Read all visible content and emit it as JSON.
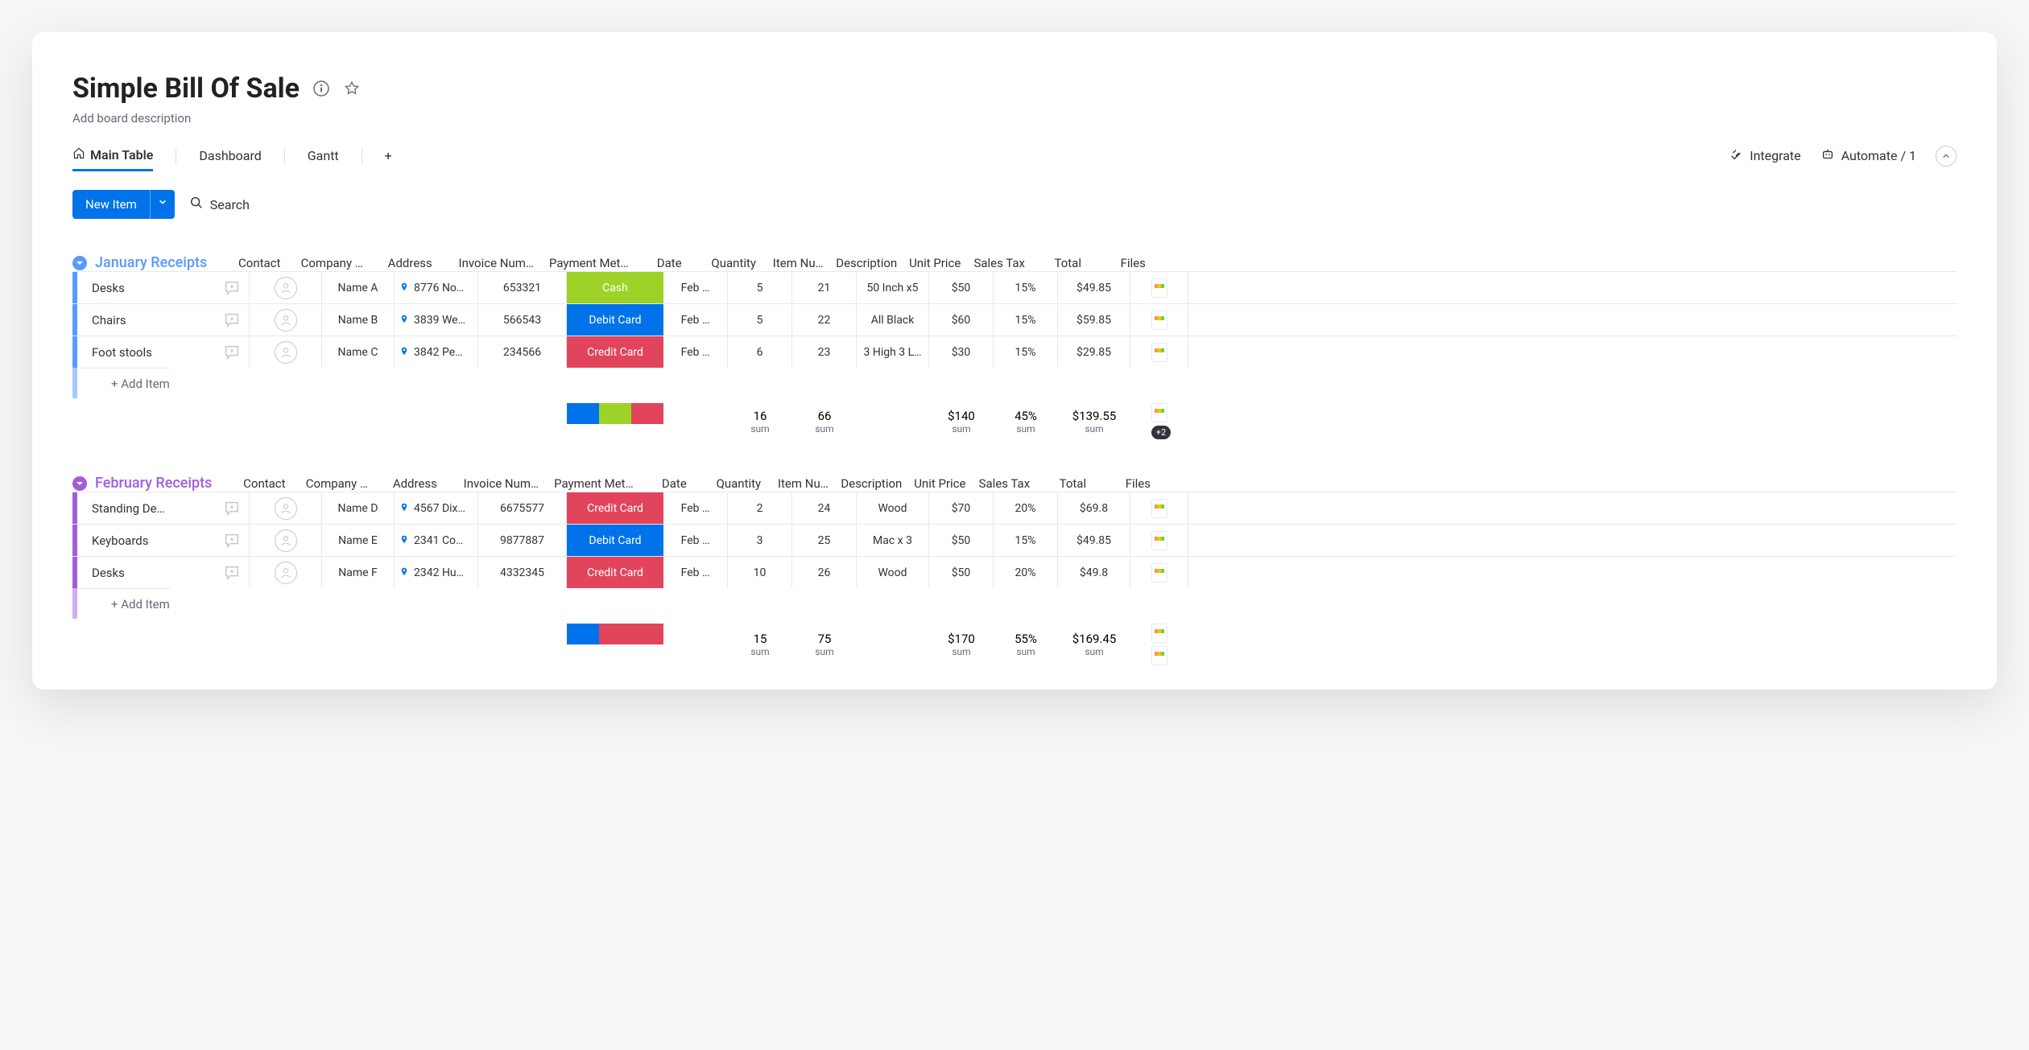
{
  "board": {
    "title": "Simple Bill Of Sale",
    "description_placeholder": "Add board description",
    "tabs": {
      "main": "Main Table",
      "dashboard": "Dashboard",
      "gantt": "Gantt",
      "add": "+"
    },
    "integrate": "Integrate",
    "automate": "Automate / 1",
    "new_item": "New Item",
    "search": "Search",
    "add_item": "+ Add Item",
    "sum_label": "sum",
    "files_more": "+2"
  },
  "columns": {
    "contact": "Contact",
    "company": "Company …",
    "address": "Address",
    "invoice": "Invoice Num…",
    "payment": "Payment Met…",
    "date": "Date",
    "quantity": "Quantity",
    "item_num": "Item Nu…",
    "description": "Description",
    "unit_price": "Unit Price",
    "sales_tax": "Sales Tax",
    "total": "Total",
    "files": "Files"
  },
  "groups": [
    {
      "name": "January Receipts",
      "color": "#579bfc",
      "nameColor": "#579bfc",
      "rows": [
        {
          "item": "Desks",
          "company": "Name A",
          "address": "8776 No…",
          "invoice": "653321",
          "payment": "Cash",
          "pay_class": "pay-cash",
          "date": "Feb …",
          "qty": "5",
          "item_num": "21",
          "desc": "50 Inch x5",
          "unit": "$50",
          "tax": "15%",
          "total": "$49.85"
        },
        {
          "item": "Chairs",
          "company": "Name B",
          "address": "3839 We…",
          "invoice": "566543",
          "payment": "Debit Card",
          "pay_class": "pay-debit",
          "date": "Feb …",
          "qty": "5",
          "item_num": "22",
          "desc": "All Black",
          "unit": "$60",
          "tax": "15%",
          "total": "$59.85"
        },
        {
          "item": "Foot stools",
          "company": "Name C",
          "address": "3842 Pe…",
          "invoice": "234566",
          "payment": "Credit Card",
          "pay_class": "pay-credit",
          "date": "Feb …",
          "qty": "6",
          "item_num": "23",
          "desc": "3 High 3 L…",
          "unit": "$30",
          "tax": "15%",
          "total": "$29.85"
        }
      ],
      "dist": [
        {
          "c": "#0073ea",
          "w": "33.33%"
        },
        {
          "c": "#9cd326",
          "w": "33.33%"
        },
        {
          "c": "#e2445c",
          "w": "33.34%"
        }
      ],
      "sums": {
        "qty": "16",
        "item_num": "66",
        "unit": "$140",
        "tax": "45%",
        "total": "$139.55",
        "files_more": "+2"
      }
    },
    {
      "name": "February Receipts",
      "color": "#a25ddc",
      "nameColor": "#a25ddc",
      "rows": [
        {
          "item": "Standing De…",
          "company": "Name D",
          "address": "4567 Dix…",
          "invoice": "6675577",
          "payment": "Credit Card",
          "pay_class": "pay-credit",
          "date": "Feb …",
          "qty": "2",
          "item_num": "24",
          "desc": "Wood",
          "unit": "$70",
          "tax": "20%",
          "total": "$69.8"
        },
        {
          "item": "Keyboards",
          "company": "Name E",
          "address": "2341 Co…",
          "invoice": "9877887",
          "payment": "Debit Card",
          "pay_class": "pay-debit",
          "date": "Feb …",
          "qty": "3",
          "item_num": "25",
          "desc": "Mac x 3",
          "unit": "$50",
          "tax": "15%",
          "total": "$49.85"
        },
        {
          "item": "Desks",
          "company": "Name F",
          "address": "2342 Hu…",
          "invoice": "4332345",
          "payment": "Credit Card",
          "pay_class": "pay-credit",
          "date": "Feb …",
          "qty": "10",
          "item_num": "26",
          "desc": "Wood",
          "unit": "$50",
          "tax": "20%",
          "total": "$49.8"
        }
      ],
      "dist": [
        {
          "c": "#0073ea",
          "w": "33.33%"
        },
        {
          "c": "#e2445c",
          "w": "66.67%"
        }
      ],
      "sums": {
        "qty": "15",
        "item_num": "75",
        "unit": "$170",
        "tax": "55%",
        "total": "$169.45"
      }
    }
  ]
}
